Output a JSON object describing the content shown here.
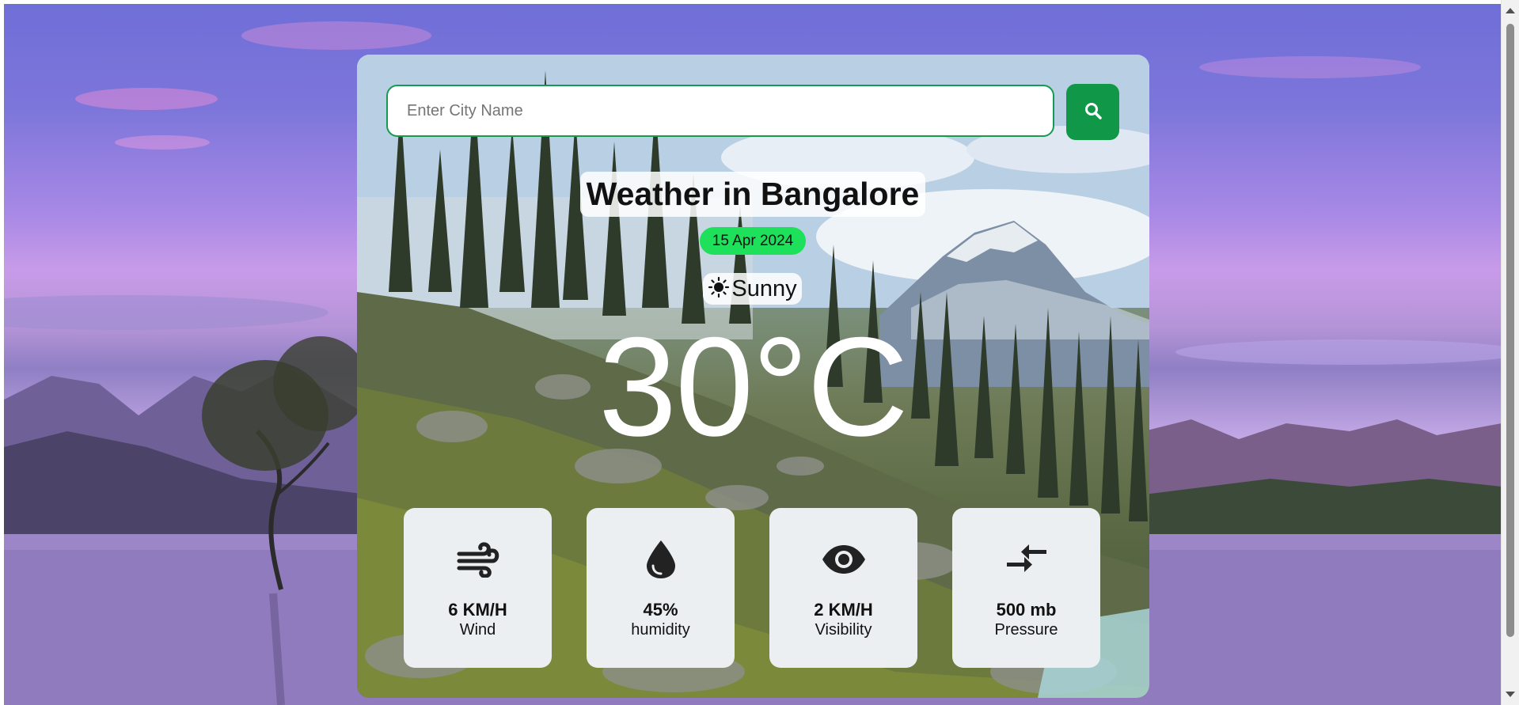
{
  "search": {
    "placeholder": "Enter City Name",
    "value": "",
    "button_icon": "search-icon"
  },
  "weather": {
    "title": "Weather in Bangalore",
    "date": "15 Apr 2024",
    "condition_icon": "sun-icon",
    "condition": "Sunny",
    "temperature": "30°C"
  },
  "stats": [
    {
      "icon": "wind-icon",
      "value": "6 KM/H",
      "label": "Wind"
    },
    {
      "icon": "humidity-drop-icon",
      "value": "45%",
      "label": "humidity"
    },
    {
      "icon": "eye-icon",
      "value": "2 KM/H",
      "label": "Visibility"
    },
    {
      "icon": "pressure-icon",
      "value": "500 mb",
      "label": "Pressure"
    }
  ],
  "colors": {
    "accent_green": "#119748",
    "date_badge": "#1ee05a",
    "stat_card_bg": "#eceff1",
    "page_bg_purple": "#7d76da"
  }
}
